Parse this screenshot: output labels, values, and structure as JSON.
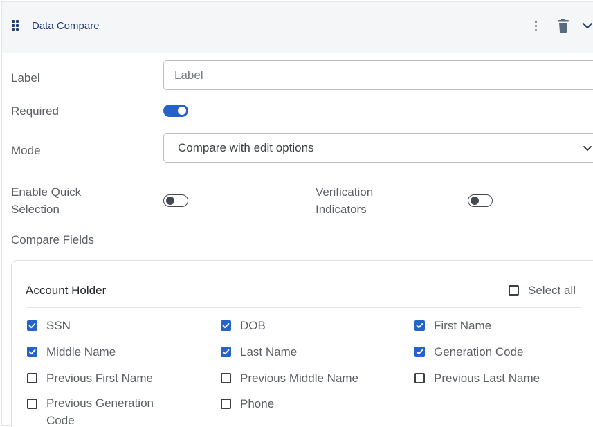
{
  "header": {
    "title": "Data Compare",
    "icons": [
      "drag-handle-icon",
      "kebab-menu-icon",
      "trash-icon",
      "chevron-down-icon"
    ]
  },
  "form": {
    "label_field": {
      "label": "Label",
      "placeholder": "Label",
      "value": ""
    },
    "required": {
      "label": "Required",
      "checked": true
    },
    "mode": {
      "label": "Mode",
      "value": "Compare with edit options"
    },
    "quick_selection": {
      "label": "Enable Quick Selection",
      "checked": false
    },
    "verification_indicators": {
      "label": "Verification Indicators",
      "checked": false
    },
    "compare_fields_label": "Compare Fields"
  },
  "compare_fields": {
    "section_title": "Account Holder",
    "select_all": {
      "label": "Select all",
      "checked": false
    },
    "items": [
      {
        "label": "SSN",
        "checked": true
      },
      {
        "label": "DOB",
        "checked": true
      },
      {
        "label": "First Name",
        "checked": true
      },
      {
        "label": "Middle Name",
        "checked": true
      },
      {
        "label": "Last Name",
        "checked": true
      },
      {
        "label": "Generation Code",
        "checked": true
      },
      {
        "label": "Previous First Name",
        "checked": false
      },
      {
        "label": "Previous Middle Name",
        "checked": false
      },
      {
        "label": "Previous Last Name",
        "checked": false
      },
      {
        "label": "Previous Generation Code",
        "checked": false
      },
      {
        "label": "Phone",
        "checked": false
      }
    ]
  },
  "colors": {
    "accent": "#2563c9",
    "header_text": "#1f3f73",
    "header_bg": "#f5f6f7"
  }
}
